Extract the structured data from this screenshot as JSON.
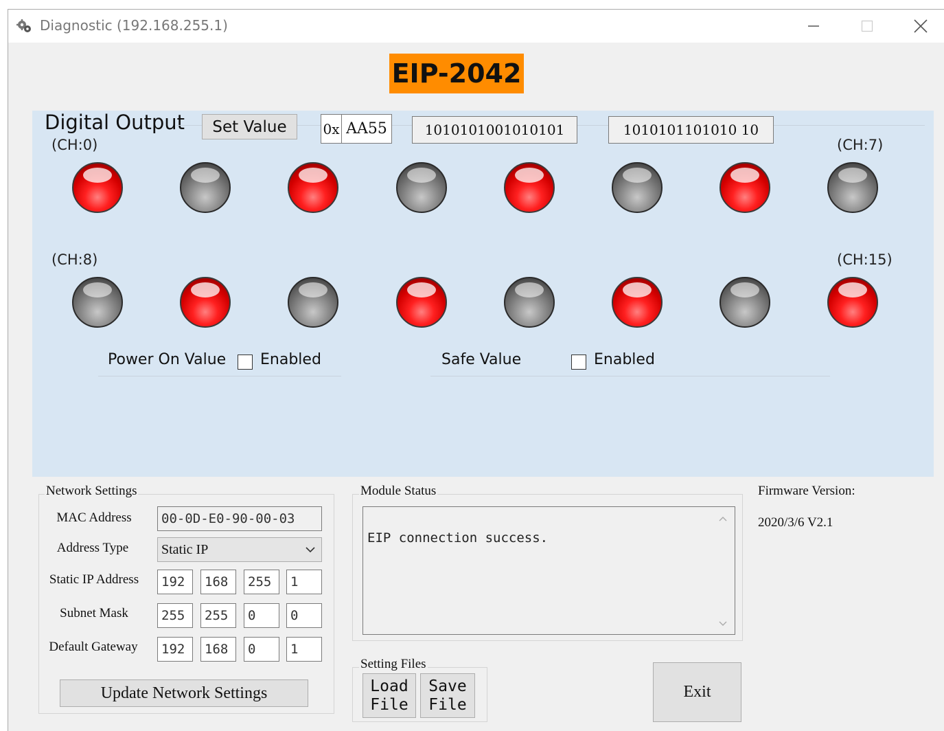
{
  "window": {
    "title": "Diagnostic (192.168.255.1)",
    "minimize_glyph": "—",
    "maximize_glyph": "☐",
    "close_glyph": "✕"
  },
  "header": {
    "model": "EIP-2042"
  },
  "digital_output": {
    "title": "Digital Output",
    "set_value_label": "Set Value",
    "hex_prefix": "0x",
    "hex_value": "AA55",
    "binary_1": "1010101001010101",
    "binary_2": "1010101101010 10",
    "row1_first_label": "(CH:0)",
    "row1_last_label": "(CH:7)",
    "row2_first_label": "(CH:8)",
    "row2_last_label": "(CH:15)",
    "channels_row1": [
      true,
      false,
      true,
      false,
      true,
      false,
      true,
      false
    ],
    "channels_row2": [
      false,
      true,
      false,
      true,
      false,
      true,
      false,
      true
    ],
    "power_on_label": "Power On Value",
    "power_on_enabled_label": "Enabled",
    "power_on_enabled": false,
    "safe_value_label": "Safe Value",
    "safe_enabled_label": "Enabled",
    "safe_enabled": false
  },
  "network": {
    "title": "Network Settings",
    "mac_label": "MAC Address",
    "mac_value": "00-0D-E0-90-00-03",
    "address_type_label": "Address Type",
    "address_type_value": "Static IP",
    "static_ip_label": "Static IP Address",
    "static_ip": [
      "192",
      "168",
      "255",
      "1"
    ],
    "subnet_label": "Subnet Mask",
    "subnet": [
      "255",
      "255",
      "0",
      "0"
    ],
    "gateway_label": "Default Gateway",
    "gateway": [
      "192",
      "168",
      "0",
      "1"
    ],
    "update_button": "Update Network Settings"
  },
  "module_status": {
    "title": "Module Status",
    "text": "EIP connection success."
  },
  "firmware": {
    "label": "Firmware Version:",
    "value": "2020/3/6 V2.1"
  },
  "setting_files": {
    "title": "Setting Files",
    "load_line1": "Load",
    "load_line2": "File",
    "save_line1": "Save",
    "save_line2": "File"
  },
  "exit_label": "Exit",
  "colors": {
    "led_on": "#ff2020",
    "led_off": "#7a7a7a",
    "brand": "#ff8c00",
    "panel": "#d8e6f3"
  }
}
